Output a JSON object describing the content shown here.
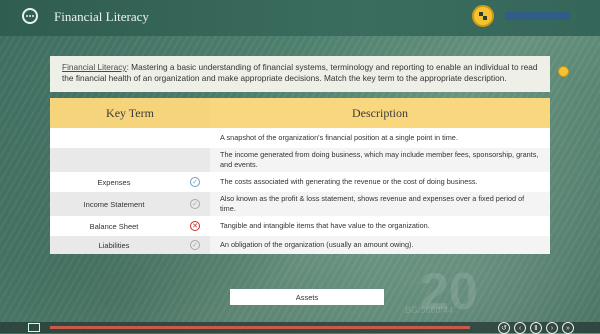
{
  "app": {
    "title": "Financial Literacy",
    "progress_fraction": 1.0
  },
  "intro": {
    "term": "Financial Literacy",
    "text": ": Mastering a basic understanding of financial systems, terminology and reporting to enable an individual to read the financial health of an organization and make appropriate decisions. Match the key term to the appropriate description."
  },
  "table": {
    "headers": {
      "key_term": "Key Term",
      "description": "Description"
    },
    "rows": [
      {
        "term": "",
        "status": "",
        "description": "A snapshot of the organization's financial position at a single point in time."
      },
      {
        "term": "",
        "status": "",
        "description": "The income generated from doing business, which may include member fees, sponsorship, grants, and events."
      },
      {
        "term": "Expenses",
        "status": "correct",
        "description": "The costs associated with generating the revenue or the cost of doing business."
      },
      {
        "term": "Income Statement",
        "status": "pending",
        "description": "Also known as the profit & loss statement, shows revenue and expenses over a fixed period of time."
      },
      {
        "term": "Balance Sheet",
        "status": "incorrect",
        "description": "Tangible and intangible items that have value to the organization."
      },
      {
        "term": "Liabilities",
        "status": "pending",
        "description": "An obligation of the organization (usually an amount owing)."
      }
    ]
  },
  "answer_tile": {
    "label": "Assets"
  },
  "watermark": {
    "text": "20",
    "serial": "BG/5660/44"
  },
  "icons": {
    "menu": "menu-dots-icon",
    "badge": "achievement-icon",
    "info": "info-icon",
    "captions": "closed-captions-icon",
    "status_correct": "check-circle-icon",
    "status_pending": "check-circle-outline-icon",
    "status_incorrect": "x-circle-icon"
  },
  "colors": {
    "header_yellow": "#f6d47b",
    "accent_gold": "#f4c430",
    "incorrect_red": "#d22b2b",
    "correct_blue": "#6aa2c8"
  }
}
